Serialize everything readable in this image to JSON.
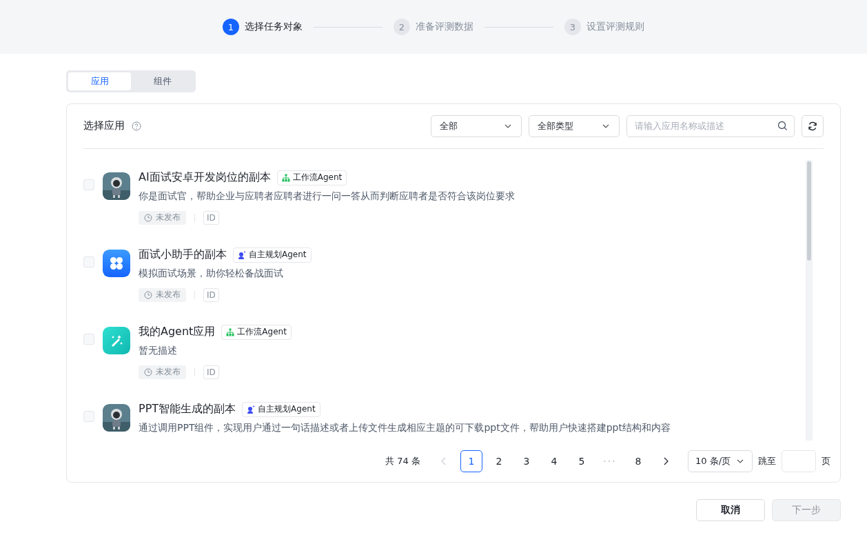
{
  "steps": [
    {
      "number": "1",
      "label": "选择任务对象",
      "selected": true
    },
    {
      "number": "2",
      "label": "准备评测数据",
      "selected": false
    },
    {
      "number": "3",
      "label": "设置评测规则",
      "selected": false
    }
  ],
  "tabs": [
    {
      "label": "应用",
      "selected": true
    },
    {
      "label": "组件",
      "selected": false
    }
  ],
  "panel": {
    "title": "选择应用",
    "filter_scope": "全部",
    "filter_type": "全部类型",
    "search": {
      "placeholder": "请输入应用名称或描述"
    }
  },
  "apps": [
    {
      "name": "AI面试安卓开发岗位的副本",
      "type": {
        "kind": "workflow",
        "label": "工作流Agent"
      },
      "description": "你是面试官，帮助企业与应聘者应聘者进行一问一答从而判断应聘者是否符合该岗位要求",
      "status": "未发布",
      "id_label": "ID",
      "checked": false
    },
    {
      "name": "面试小助手的副本",
      "avatar": {
        "kind": "clover"
      },
      "type": {
        "kind": "autonomous",
        "label": "自主规划Agent"
      },
      "description": "模拟面试场景，助你轻松备战面试",
      "status": "未发布",
      "id_label": "ID",
      "checked": false
    },
    {
      "name": "我的Agent应用",
      "avatar": {
        "kind": "wand"
      },
      "type": {
        "kind": "workflow",
        "label": "工作流Agent"
      },
      "description": "暂无描述",
      "status": "未发布",
      "id_label": "ID",
      "checked": false
    },
    {
      "name": "PPT智能生成的副本",
      "type": {
        "kind": "autonomous",
        "label": "自主规划Agent"
      },
      "description": "通过调用PPT组件，实现用户通过一句话描述或者上传文件生成相应主题的可下载ppt文件，帮助用户快速搭建ppt结构和内容",
      "checked": false
    }
  ],
  "pagination": {
    "total": "共 74 条",
    "prev_disabled": true,
    "pages": [
      {
        "kind": "page",
        "label": "1",
        "selected": true
      },
      {
        "kind": "page",
        "label": "2",
        "selected": false
      },
      {
        "kind": "page",
        "label": "3",
        "selected": false
      },
      {
        "kind": "page",
        "label": "4",
        "selected": false
      },
      {
        "kind": "page",
        "label": "5",
        "selected": false
      },
      {
        "kind": "ellipsis",
        "label": "···",
        "selected": false
      },
      {
        "kind": "page",
        "label": "8",
        "selected": false
      }
    ],
    "page_size": "10 条/页",
    "jump_label": "跳至",
    "page_unit": "页"
  },
  "footer": {
    "cancel": "取消",
    "next": "下一步",
    "next_disabled": true
  }
}
